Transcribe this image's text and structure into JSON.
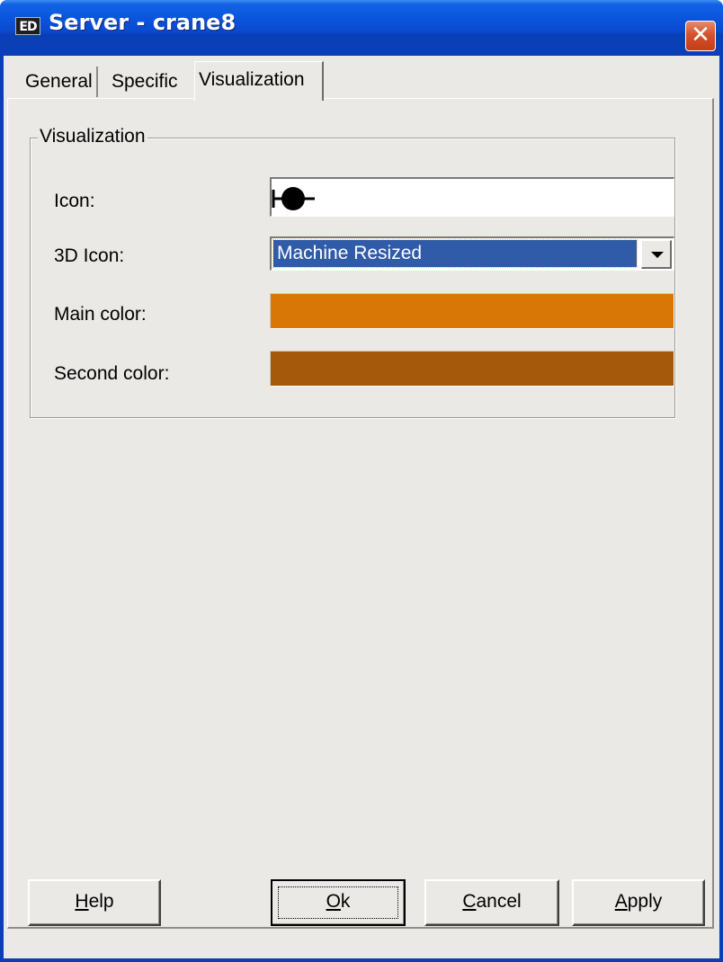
{
  "window": {
    "icon_text": "ED",
    "title": "Server - crane8",
    "close_glyph": "✕"
  },
  "tabs": [
    {
      "label": "General",
      "active": false
    },
    {
      "label": "Specific",
      "active": false
    },
    {
      "label": "Visualization",
      "active": true
    }
  ],
  "group": {
    "legend": "Visualization",
    "icon_label": "Icon:",
    "icon_value": "filled-circle-with-line-icon",
    "icon3d_label": "3D Icon:",
    "icon3d_value": "Machine Resized",
    "main_color_label": "Main color:",
    "main_color": "#d97706",
    "second_color_label": "Second color:",
    "second_color": "#a55a0b"
  },
  "buttons": {
    "help": {
      "mnemonic": "H",
      "rest": "elp"
    },
    "ok": {
      "mnemonic": "O",
      "rest": "k"
    },
    "cancel": {
      "mnemonic": "C",
      "rest": "ancel"
    },
    "apply": {
      "mnemonic": "A",
      "rest": "pply"
    }
  },
  "colors": {
    "titlebar": "#0a55dc",
    "dialog_bg": "#ebe9e6",
    "selection": "#305ba8"
  }
}
